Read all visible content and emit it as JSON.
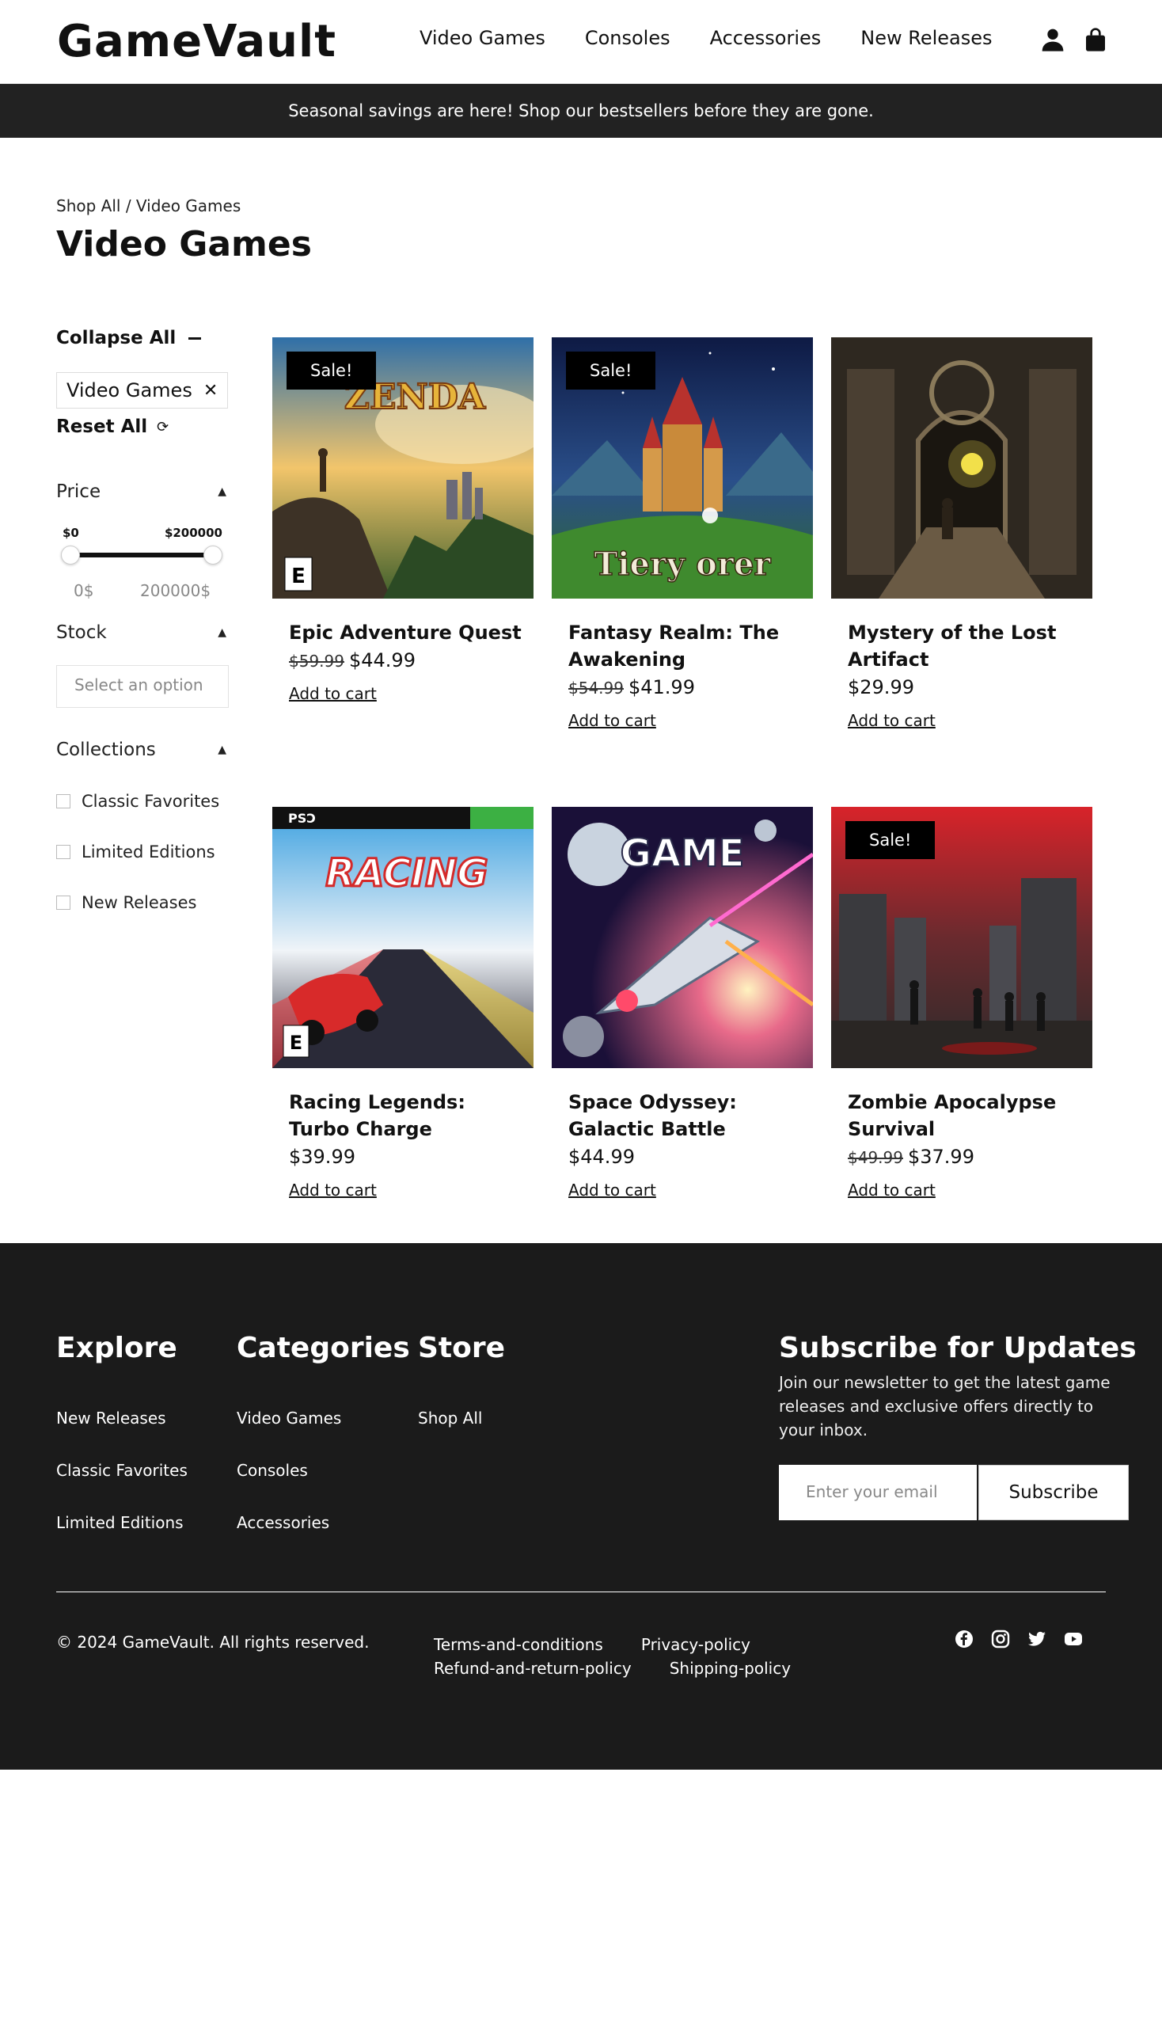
{
  "header": {
    "logo": "GameVault",
    "nav": [
      "Video Games",
      "Consoles",
      "Accessories",
      "New Releases"
    ]
  },
  "announcement": "Seasonal savings are here! Shop our bestsellers before they are gone.",
  "breadcrumb": "Shop All / Video Games",
  "page_title": "Video Games",
  "filters": {
    "collapse_label": "Collapse All",
    "active_chip": "Video Games",
    "reset_label": "Reset All",
    "price": {
      "title": "Price",
      "min_label": "$0",
      "max_label": "$200000",
      "min_value": "0$",
      "max_value": "200000$"
    },
    "stock": {
      "title": "Stock",
      "placeholder": "Select an option"
    },
    "collections": {
      "title": "Collections",
      "options": [
        "Classic Favorites",
        "Limited Editions",
        "New Releases"
      ]
    }
  },
  "sale_badge": "Sale!",
  "add_to_cart": "Add to cart",
  "products": [
    {
      "name": "Epic Adventure Quest",
      "old_price": "$59.99",
      "price": "$44.99",
      "sale": true,
      "art_text": "ZENDA"
    },
    {
      "name": "Fantasy Realm: The Awakening",
      "old_price": "$54.99",
      "price": "$41.99",
      "sale": true,
      "art_text": "Tiery  orer"
    },
    {
      "name": "Mystery of the Lost Artifact",
      "old_price": "",
      "price": "$29.99",
      "sale": false,
      "art_text": ""
    },
    {
      "name": "Racing Legends: Turbo Charge",
      "old_price": "",
      "price": "$39.99",
      "sale": false,
      "art_text": "RACING"
    },
    {
      "name": "Space Odyssey: Galactic Battle",
      "old_price": "",
      "price": "$44.99",
      "sale": false,
      "art_text": "GAME"
    },
    {
      "name": "Zombie Apocalypse Survival",
      "old_price": "$49.99",
      "price": "$37.99",
      "sale": true,
      "art_text": ""
    }
  ],
  "footer": {
    "explore": {
      "title": "Explore",
      "links": [
        "New Releases",
        "Classic Favorites",
        "Limited Editions"
      ]
    },
    "categories": {
      "title": "Categories",
      "links": [
        "Video Games",
        "Consoles",
        "Accessories"
      ]
    },
    "store": {
      "title": "Store",
      "links": [
        "Shop All"
      ]
    },
    "subscribe": {
      "title": "Subscribe for Updates",
      "text": "Join our newsletter to get the latest game releases and exclusive offers directly to your inbox.",
      "placeholder": "Enter your email",
      "button": "Subscribe"
    },
    "copyright": "© 2024 GameVault. All rights reserved.",
    "legal": [
      "Terms-and-conditions",
      "Privacy-policy",
      "Refund-and-return-policy",
      "Shipping-policy"
    ],
    "social_icons": [
      "facebook-icon",
      "instagram-icon",
      "twitter-icon",
      "youtube-icon"
    ]
  },
  "colors": {
    "dark": "#1b1b1b",
    "banner": "#222222",
    "text": "#111111"
  }
}
